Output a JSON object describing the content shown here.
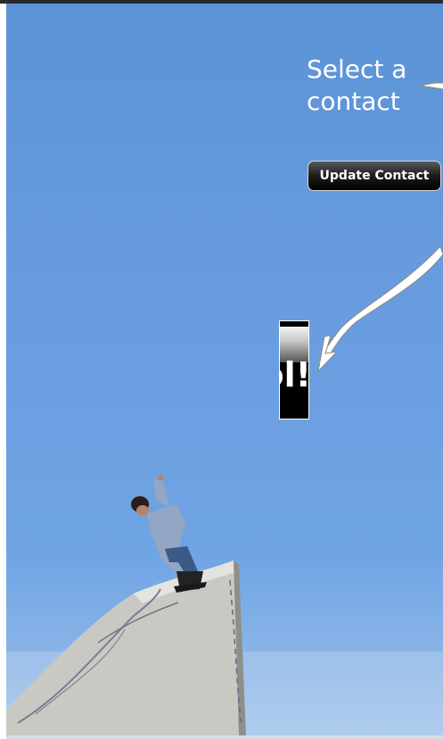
{
  "hint": {
    "label": "Select a\ncontact"
  },
  "actions": {
    "update_contact_label": "Update Contact"
  },
  "widget": {
    "visible_text": "ol!"
  },
  "colors": {
    "sky": "#6a9de0",
    "button_fill": "#000000",
    "text": "#ffffff"
  },
  "icons": {
    "pointer_top": "arrow-left-icon",
    "pointer_widget": "arrow-down-left-icon"
  }
}
